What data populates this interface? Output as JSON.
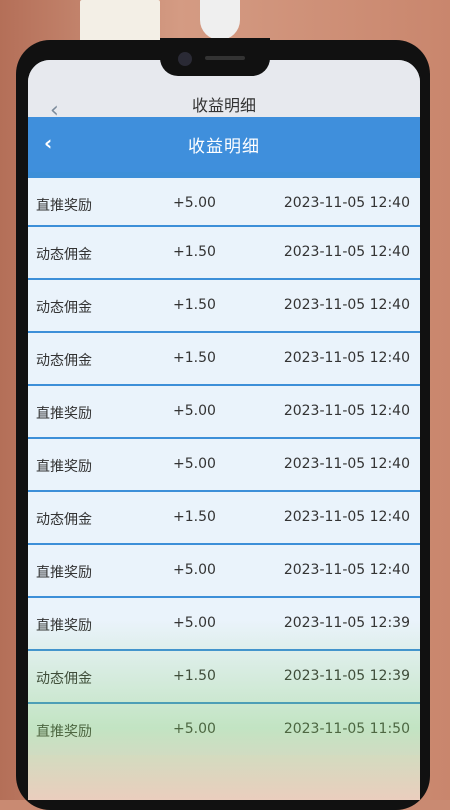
{
  "header": {
    "outer_title": "收益明细",
    "title": "收益明细",
    "back_glyph": "‹"
  },
  "records": [
    {
      "type": "直推奖励",
      "amount": "+5.00",
      "time": "2023-11-05 12:40"
    },
    {
      "type": "动态佣金",
      "amount": "+1.50",
      "time": "2023-11-05 12:40"
    },
    {
      "type": "动态佣金",
      "amount": "+1.50",
      "time": "2023-11-05 12:40"
    },
    {
      "type": "动态佣金",
      "amount": "+1.50",
      "time": "2023-11-05 12:40"
    },
    {
      "type": "直推奖励",
      "amount": "+5.00",
      "time": "2023-11-05 12:40"
    },
    {
      "type": "直推奖励",
      "amount": "+5.00",
      "time": "2023-11-05 12:40"
    },
    {
      "type": "动态佣金",
      "amount": "+1.50",
      "time": "2023-11-05 12:40"
    },
    {
      "type": "直推奖励",
      "amount": "+5.00",
      "time": "2023-11-05 12:40"
    },
    {
      "type": "直推奖励",
      "amount": "+5.00",
      "time": "2023-11-05 12:39"
    },
    {
      "type": "动态佣金",
      "amount": "+1.50",
      "time": "2023-11-05 12:39"
    },
    {
      "type": "直推奖励",
      "amount": "+5.00",
      "time": "2023-11-05 11:50"
    }
  ],
  "colors": {
    "header_blue": "#3f8fdc",
    "row_background": "#eaf3fb",
    "divider_blue": "#3d8fd8"
  }
}
